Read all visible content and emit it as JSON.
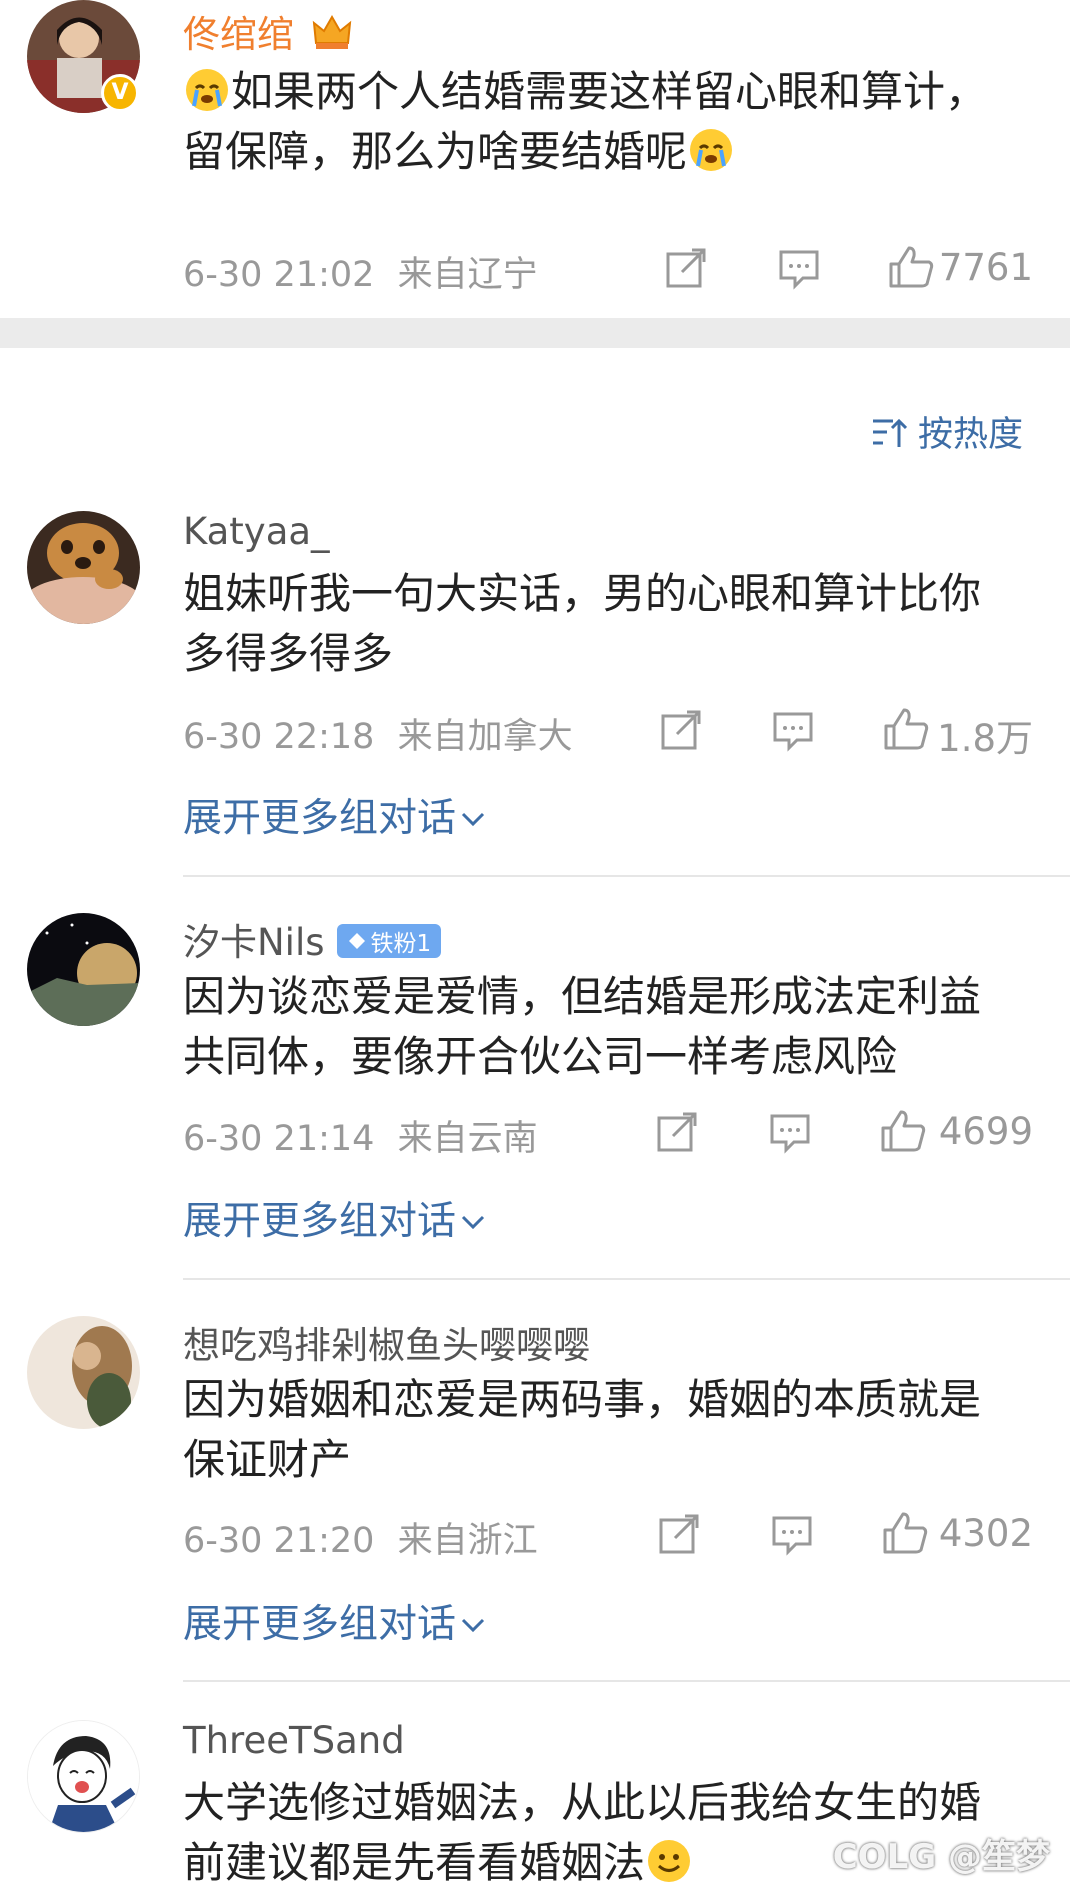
{
  "top_comment": {
    "username": "佟绾绾",
    "text": "如果两个人结婚需要这样留心眼和算计，留保障，那么为啥要结婚呢",
    "time": "6-30 21:02",
    "location": "来自辽宁",
    "likes": "7761"
  },
  "sort": {
    "label": "按热度",
    "icon": "sort-icon"
  },
  "comments": [
    {
      "username": "Katyaa_",
      "text": "姐妹听我一句大实话，男的心眼和算计比你多得多得多",
      "time": "6-30 22:18",
      "location": "来自加拿大",
      "likes": "1.8万",
      "expand": "展开更多组对话"
    },
    {
      "username": "汐卡Nils",
      "badge": "铁粉1",
      "text": "因为谈恋爱是爱情，但结婚是形成法定利益共同体，要像开合伙公司一样考虑风险",
      "time": "6-30 21:14",
      "location": "来自云南",
      "likes": "4699",
      "expand": "展开更多组对话"
    },
    {
      "username": "想吃鸡排剁椒鱼头嘤嘤嘤",
      "text": "因为婚姻和恋爱是两码事，婚姻的本质就是保证财产",
      "time": "6-30 21:20",
      "location": "来自浙江",
      "likes": "4302",
      "expand": "展开更多组对话"
    },
    {
      "username": "ThreeTSand",
      "text": "大学选修过婚姻法，从此以后我给女生的婚前建议都是先看看婚姻法"
    }
  ],
  "watermark": "COLG @笙梦",
  "colors": {
    "accent": "#3d6da6",
    "username_vip": "#f07f2e",
    "badge": "#6ea8f0",
    "meta": "#999999"
  }
}
